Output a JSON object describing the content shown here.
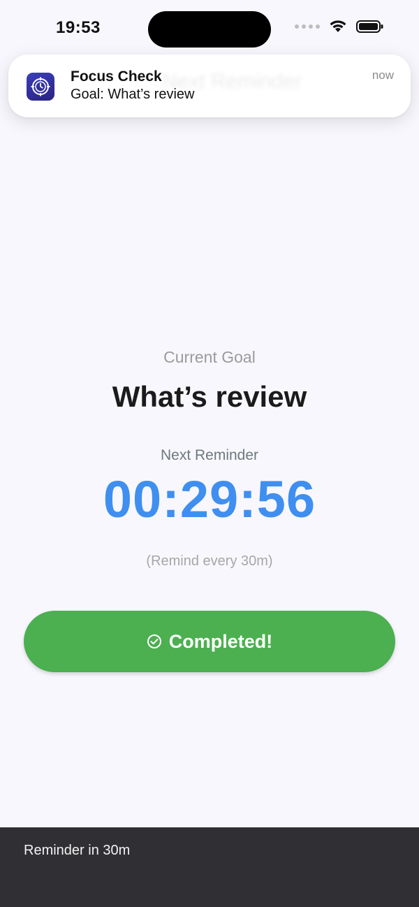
{
  "status_bar": {
    "time": "19:53"
  },
  "notification": {
    "app_name": "Focus Check",
    "message": "Goal: What’s review",
    "time": "now",
    "ghost_text": "Next Reminder",
    "icon": "focus-check-app-icon"
  },
  "main": {
    "goal_label": "Current Goal",
    "goal_title": "What’s review",
    "next_reminder_label": "Next Reminder",
    "timer": "00:29:56",
    "remind_every": "(Remind every 30m)",
    "complete_button_label": "Completed!"
  },
  "bottom_bar": {
    "text": "Reminder in 30m"
  },
  "colors": {
    "accent_blue": "#3f8ff0",
    "button_green": "#4caf50",
    "bottom_bar": "#303034",
    "background": "#f8f7fd"
  }
}
